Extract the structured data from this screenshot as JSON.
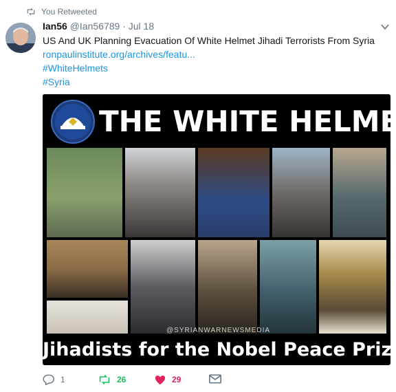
{
  "retweet_banner": {
    "icon": "retweet-icon",
    "text": "You Retweeted"
  },
  "tweet": {
    "author_name": "Ian56",
    "author_handle": "@Ian56789",
    "separator": "·",
    "date": "Jul 18",
    "text": "US And UK Planning Evacuation Of White Helmet Jihadi Terrorists From Syria",
    "link": "ronpaulinstitute.org/archives/featu...",
    "hashtags": [
      "#WhiteHelmets",
      "#Syria"
    ]
  },
  "media": {
    "title": "THE WHITE HELMETS",
    "caption": "Jihadists for the Nobel Peace Prize.",
    "watermark": "@SYRIANWARNEWSMEDIA"
  },
  "actions": {
    "reply": {
      "icon": "reply-icon",
      "count": "1"
    },
    "retweet": {
      "icon": "retweet-icon",
      "count": "26",
      "color": "#17bf63"
    },
    "like": {
      "icon": "heart-icon",
      "count": "29",
      "color": "#e0245e"
    },
    "dm": {
      "icon": "envelope-icon"
    }
  },
  "colors": {
    "link": "#1b95e0",
    "muted": "#657786",
    "text": "#14171a"
  }
}
